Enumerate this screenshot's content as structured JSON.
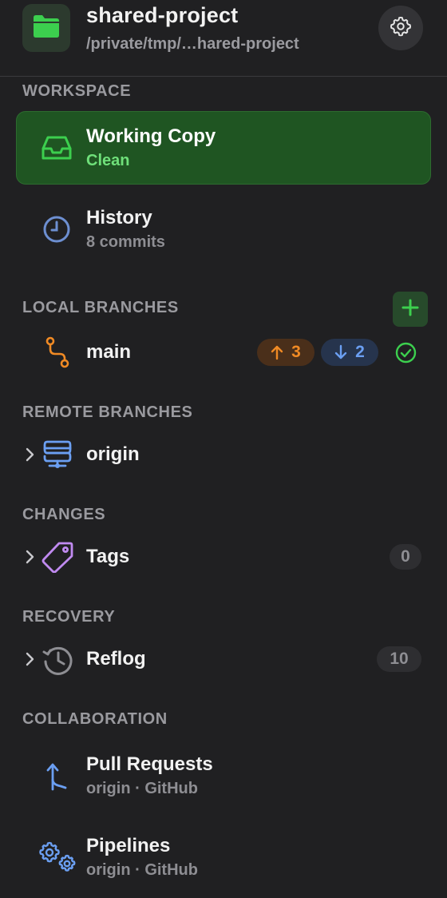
{
  "header": {
    "project_name": "shared-project",
    "project_path": "/private/tmp/…hared-project"
  },
  "sections": {
    "workspace": "WORKSPACE",
    "local_branches": "LOCAL BRANCHES",
    "remote_branches": "REMOTE BRANCHES",
    "changes": "CHANGES",
    "recovery": "RECOVERY",
    "collaboration": "COLLABORATION"
  },
  "workspace": {
    "working_copy": {
      "title": "Working Copy",
      "status": "Clean"
    },
    "history": {
      "title": "History",
      "subtitle": "8 commits"
    }
  },
  "local_branches": {
    "branch": {
      "name": "main",
      "ahead": "3",
      "behind": "2"
    }
  },
  "remote_branches": {
    "remote": {
      "name": "origin"
    }
  },
  "changes": {
    "tags": {
      "label": "Tags",
      "count": "0"
    }
  },
  "recovery": {
    "reflog": {
      "label": "Reflog",
      "count": "10"
    }
  },
  "collaboration": {
    "pull_requests": {
      "title": "Pull Requests",
      "subtitle": "origin · GitHub"
    },
    "pipelines": {
      "title": "Pipelines",
      "subtitle": "origin · GitHub"
    }
  },
  "colors": {
    "accent_green": "#3ccf4e",
    "working_copy_bg": "#1f5522",
    "ahead_orange": "#f08a24",
    "behind_blue": "#6b9ff2",
    "tag_purple": "#c08af0"
  },
  "icons": [
    "folder-icon",
    "gear-icon",
    "inbox-icon",
    "clock-icon",
    "plus-icon",
    "branch-icon",
    "arrow-up-icon",
    "arrow-down-icon",
    "check-circle-icon",
    "chevron-right-icon",
    "server-icon",
    "tag-icon",
    "history-icon",
    "pull-request-icon",
    "gears-icon"
  ]
}
